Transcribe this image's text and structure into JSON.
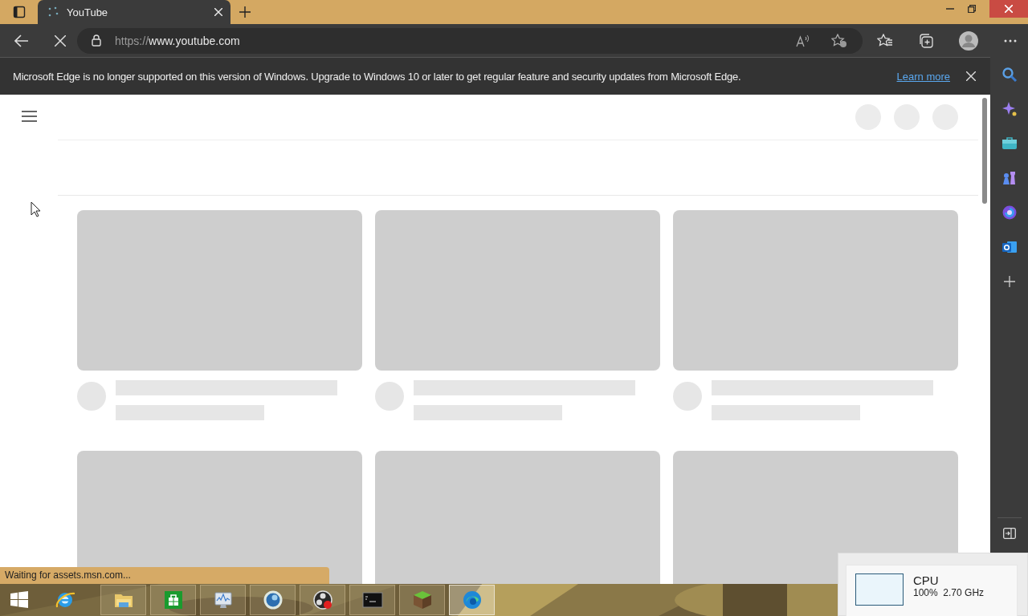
{
  "window": {
    "controls": [
      {
        "kind": "minimize"
      },
      {
        "kind": "restore"
      },
      {
        "kind": "close"
      }
    ]
  },
  "tabs": [
    {
      "title": "YouTube",
      "selected": true,
      "loading": true
    }
  ],
  "toolbar": {
    "loading": true,
    "url_scheme": "https://",
    "url_host": "www.youtube.com"
  },
  "infobar": {
    "message": "Microsoft Edge is no longer supported on this version of Windows. Upgrade to Windows 10 or later to get regular feature and security updates from Microsoft Edge.",
    "link": "Learn more"
  },
  "sidebar": {
    "items": [
      {
        "kind": "search"
      },
      {
        "kind": "sparkle"
      },
      {
        "kind": "briefcase"
      },
      {
        "kind": "chess"
      },
      {
        "kind": "ring"
      },
      {
        "kind": "mail"
      },
      {
        "kind": "add"
      }
    ]
  },
  "feed": {
    "rows": [
      {
        "cards": [
          {
            "kind": "skeleton"
          },
          {
            "kind": "skeleton"
          },
          {
            "kind": "skeleton"
          }
        ]
      },
      {
        "cards": [
          {
            "kind": "thumbnail"
          },
          {
            "kind": "thumbnail"
          },
          {
            "kind": "thumbnail"
          }
        ]
      }
    ]
  },
  "status_bar": {
    "text": "Waiting for assets.msn.com..."
  },
  "cpu_popup": {
    "label": "CPU",
    "reading": "100%  2.70 GHz"
  },
  "taskbar": {
    "items": [
      {
        "kind": "start",
        "selected": false
      },
      {
        "kind": "ie",
        "selected": false
      },
      {
        "kind": "folder",
        "selected": false
      },
      {
        "kind": "store",
        "selected": false
      },
      {
        "kind": "monitor",
        "selected": false
      },
      {
        "kind": "globe",
        "selected": false
      },
      {
        "kind": "record",
        "selected": false
      },
      {
        "kind": "terminal",
        "selected": false
      },
      {
        "kind": "block",
        "selected": false
      },
      {
        "kind": "edge",
        "selected": true
      }
    ]
  }
}
